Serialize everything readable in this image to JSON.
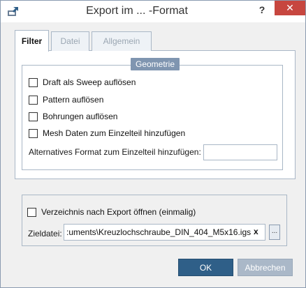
{
  "window": {
    "title": "Export im       ...    -Format",
    "help": "?",
    "close": "✕"
  },
  "tabs": [
    {
      "label": "Filter",
      "active": true
    },
    {
      "label": "Datei",
      "active": false
    },
    {
      "label": "Allgemein",
      "active": false
    }
  ],
  "geometrie": {
    "title": "Geometrie",
    "options": [
      {
        "label": "Draft als Sweep auflösen",
        "checked": false
      },
      {
        "label": "Pattern auflösen",
        "checked": false
      },
      {
        "label": "Bohrungen auflösen",
        "checked": false
      },
      {
        "label": "Mesh Daten zum Einzelteil hinzufügen",
        "checked": false
      }
    ],
    "alt_format_label": "Alternatives Format zum Einzelteil hinzufügen:",
    "alt_format_value": ""
  },
  "export": {
    "open_dir_label": "Verzeichnis nach Export öffnen (einmalig)",
    "open_dir_checked": false,
    "target_label": "Zieldatei:",
    "target_value": ":uments\\Kreuzlochschraube_DIN_404_M5x16.igs",
    "clear": "x",
    "browse": "..."
  },
  "buttons": {
    "ok": "OK",
    "cancel": "Abbrechen"
  }
}
